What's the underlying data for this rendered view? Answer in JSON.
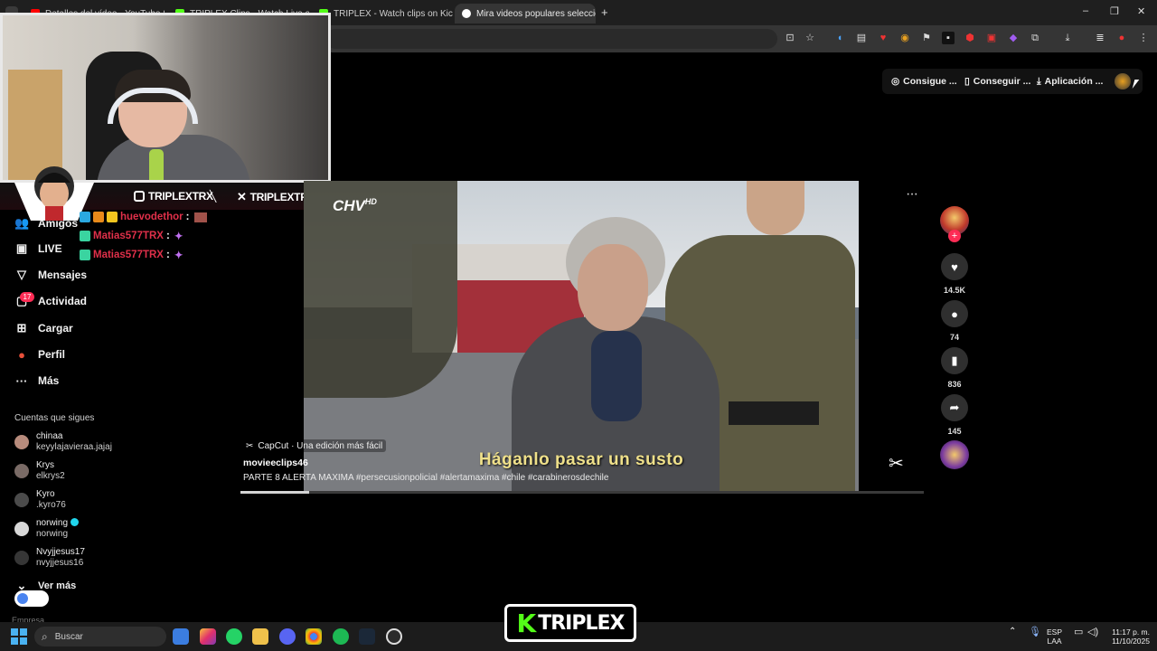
{
  "browser": {
    "tabs": [
      {
        "title": "Detalles del vídeo - YouTube St",
        "fav_color": "#ff0000",
        "close": "✕"
      },
      {
        "title": "TRIPLEX Clips - Watch Live on K",
        "fav_color": "#53fc18",
        "close": "✕"
      },
      {
        "title": "TRIPLEX - Watch clips on Kick",
        "fav_color": "#53fc18",
        "close": "✕"
      },
      {
        "title": "Mira videos populares seleccion",
        "fav_color": "#ffffff",
        "close": "✕"
      }
    ],
    "new_tab": "+",
    "window_controls": [
      "–",
      "❐",
      "✕"
    ]
  },
  "page": {
    "top_buttons": [
      {
        "label": "Consigue ...",
        "icon": "coin-icon",
        "glyph": "◎"
      },
      {
        "label": "Conseguir ...",
        "icon": "phone-icon",
        "glyph": "▯"
      },
      {
        "label": "Aplicación ...",
        "icon": "download-icon",
        "glyph": "⤓"
      }
    ]
  },
  "overlay": {
    "instagram": "TRIPLEXTRX",
    "x": "TRIPLEXTRX",
    "separator": "╲",
    "chat": [
      {
        "user": "huevodethor",
        "sep": ":"
      },
      {
        "user": "Matias577TRX",
        "sep": ":"
      },
      {
        "user": "Matias577TRX",
        "sep": ":"
      }
    ],
    "logo_k": "K",
    "logo_text": "TRIPLEX"
  },
  "sidebar": {
    "nav": [
      {
        "label": "Amigos",
        "glyph": "👥"
      },
      {
        "label": "LIVE",
        "glyph": "▣"
      },
      {
        "label": "Mensajes",
        "glyph": "▽"
      },
      {
        "label": "Actividad",
        "glyph": "▢",
        "badge": "17"
      },
      {
        "label": "Cargar",
        "glyph": "⊞"
      },
      {
        "label": "Perfil",
        "glyph": "●"
      },
      {
        "label": "Más",
        "glyph": "···"
      }
    ],
    "following_title": "Cuentas que sigues",
    "accounts": [
      {
        "name": "chinaa",
        "handle": "keyylajavieraa.jajaj"
      },
      {
        "name": "Krys",
        "handle": "elkrys2"
      },
      {
        "name": "Kyro",
        "handle": ".kyro76"
      },
      {
        "name": "norwing",
        "handle": "norwing",
        "verified": true
      },
      {
        "name": "Nvyjjesus17",
        "handle": "nvyjjesus16"
      }
    ],
    "see_more": "Ver más",
    "cutoff": "Empresa"
  },
  "video": {
    "channel_logo": "CHV",
    "channel_hd": "HD",
    "subtitle": "Háganlo pasar un susto",
    "capcut_label": "CapCut · Una edición más fácil",
    "username": "movieeclips46",
    "description": "PARTE 8 ALERTA MAXIMA #persecusionpolicial  #alertamaxima  #chile  #carabinerosdechile",
    "progress": 0.1,
    "more": "···"
  },
  "actions": {
    "likes": "14.5K",
    "comments": "74",
    "saves": "836",
    "shares": "145",
    "follow_glyph": "+"
  },
  "taskbar": {
    "search_placeholder": "Buscar",
    "lang_top": "ESP",
    "lang_bottom": "LAA",
    "time": "11:17 p. m.",
    "date": "11/10/2025"
  },
  "colors": {
    "accent_red": "#fe2c55",
    "kick_green": "#53fc18",
    "chat_user": "#e0304a"
  }
}
